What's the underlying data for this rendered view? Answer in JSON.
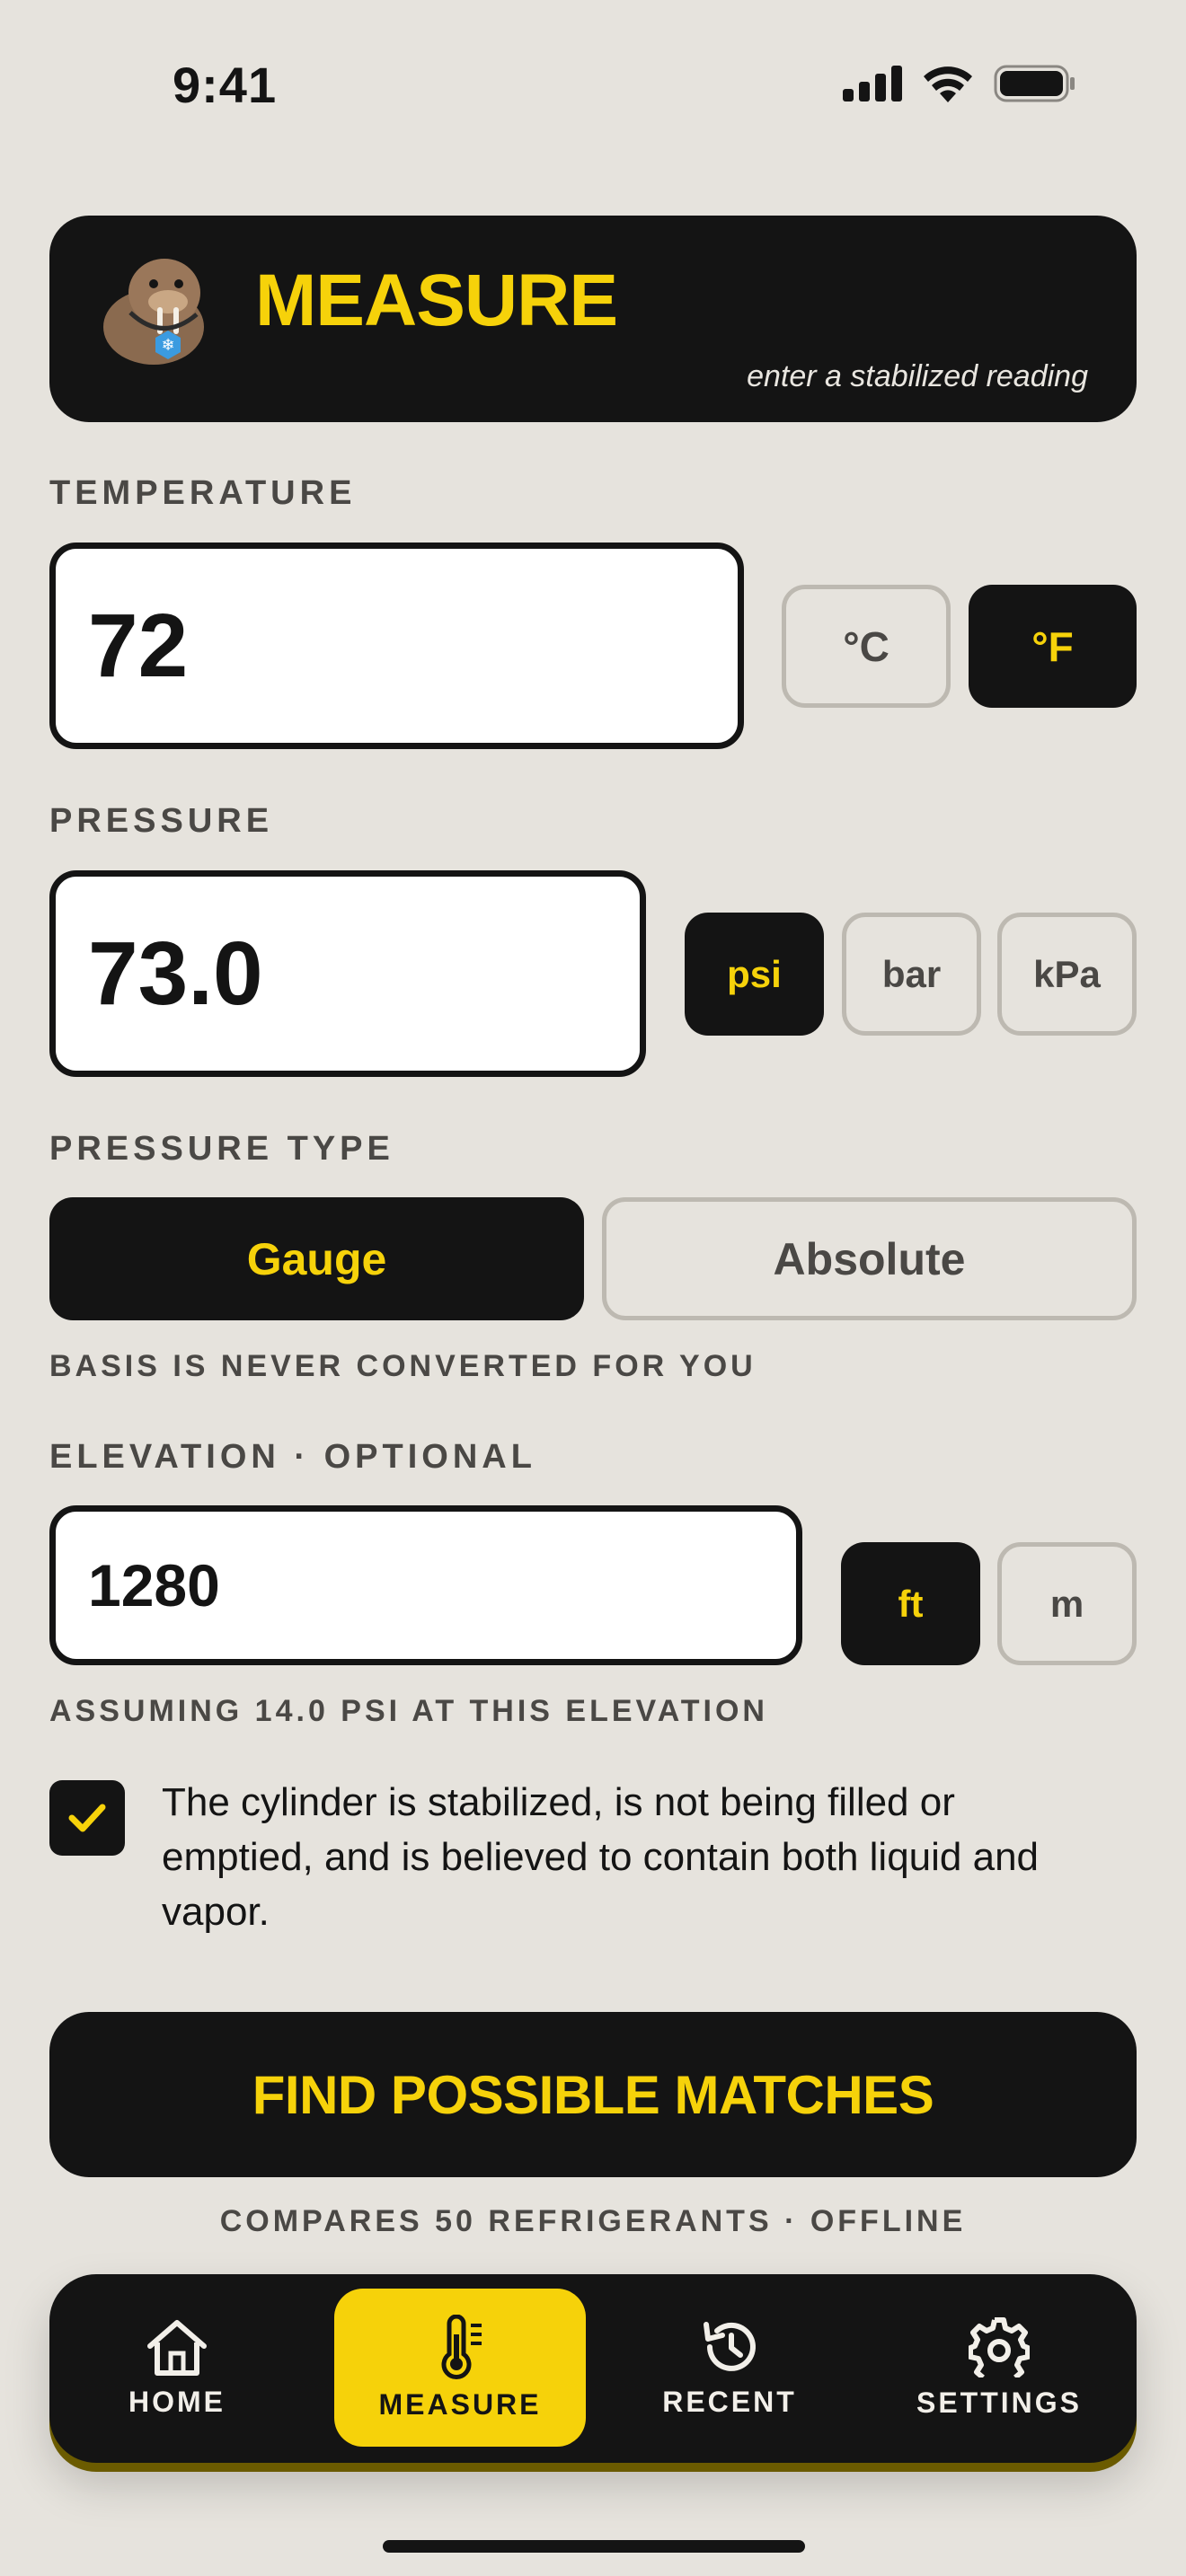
{
  "status": {
    "time": "9:41"
  },
  "header": {
    "title": "MEASURE",
    "subtitle": "enter a stabilized reading"
  },
  "temperature": {
    "label": "TEMPERATURE",
    "value": "72",
    "units": [
      {
        "label": "°C",
        "selected": false
      },
      {
        "label": "°F",
        "selected": true
      }
    ]
  },
  "pressure": {
    "label": "PRESSURE",
    "value": "73.0",
    "units": [
      {
        "label": "psi",
        "selected": true
      },
      {
        "label": "bar",
        "selected": false
      },
      {
        "label": "kPa",
        "selected": false
      }
    ]
  },
  "pressure_type": {
    "label": "PRESSURE TYPE",
    "options": [
      {
        "label": "Gauge",
        "selected": true
      },
      {
        "label": "Absolute",
        "selected": false
      }
    ],
    "note": "BASIS IS NEVER CONVERTED FOR YOU"
  },
  "elevation": {
    "label": "ELEVATION · OPTIONAL",
    "value": "1280",
    "units": [
      {
        "label": "ft",
        "selected": true
      },
      {
        "label": "m",
        "selected": false
      }
    ],
    "note": "ASSUMING 14.0 PSI AT THIS ELEVATION"
  },
  "confirmation": {
    "checked": true,
    "text": "The cylinder is stabilized, is not being filled or emptied, and is believed to contain both liquid and vapor."
  },
  "cta": {
    "label": "FIND POSSIBLE MATCHES",
    "note": "COMPARES 50 REFRIGERANTS · OFFLINE"
  },
  "tabbar": {
    "items": [
      {
        "label": "HOME",
        "icon": "home-icon",
        "active": false
      },
      {
        "label": "MEASURE",
        "icon": "thermometer-icon",
        "active": true
      },
      {
        "label": "RECENT",
        "icon": "history-icon",
        "active": false
      },
      {
        "label": "SETTINGS",
        "icon": "gear-icon",
        "active": false
      }
    ]
  },
  "colors": {
    "accent": "#f6d20a",
    "dark": "#141414",
    "background": "#e6e3dd"
  }
}
